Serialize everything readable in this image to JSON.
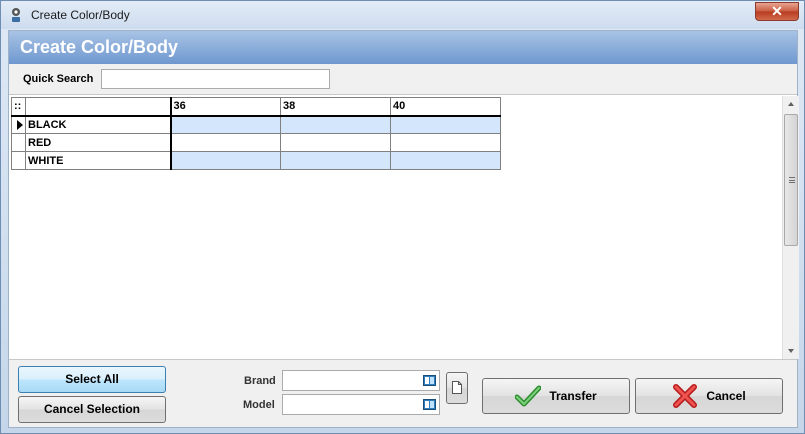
{
  "window": {
    "title": "Create Color/Body",
    "close_label": "✕"
  },
  "header": {
    "title": "Create Color/Body"
  },
  "search": {
    "label": "Quick Search",
    "value": "",
    "placeholder": ""
  },
  "grid": {
    "corner": "::",
    "columns": [
      "36",
      "38",
      "40"
    ],
    "rows": [
      {
        "label": "BLACK",
        "cells": [
          "",
          "",
          ""
        ],
        "current": true
      },
      {
        "label": "RED",
        "cells": [
          "",
          "",
          ""
        ],
        "current": false
      },
      {
        "label": "WHITE",
        "cells": [
          "",
          "",
          ""
        ],
        "current": false
      }
    ]
  },
  "buttons": {
    "select_all": "Select All",
    "cancel_selection": "Cancel Selection",
    "transfer": "Transfer",
    "cancel": "Cancel"
  },
  "fields": {
    "brand_label": "Brand",
    "brand_value": "",
    "model_label": "Model",
    "model_value": ""
  },
  "colors": {
    "header_band": "#6f98cf",
    "alt_row": "#d4e6fb",
    "transfer_icon": "#4caf50",
    "cancel_icon": "#e53935"
  },
  "icons": {
    "app": "app-icon",
    "close": "close-icon",
    "lookup": "lookup-icon",
    "new_document": "document-icon",
    "transfer": "checkmark-icon",
    "cancel": "red-x-icon",
    "row_pointer": "row-pointer-icon"
  }
}
